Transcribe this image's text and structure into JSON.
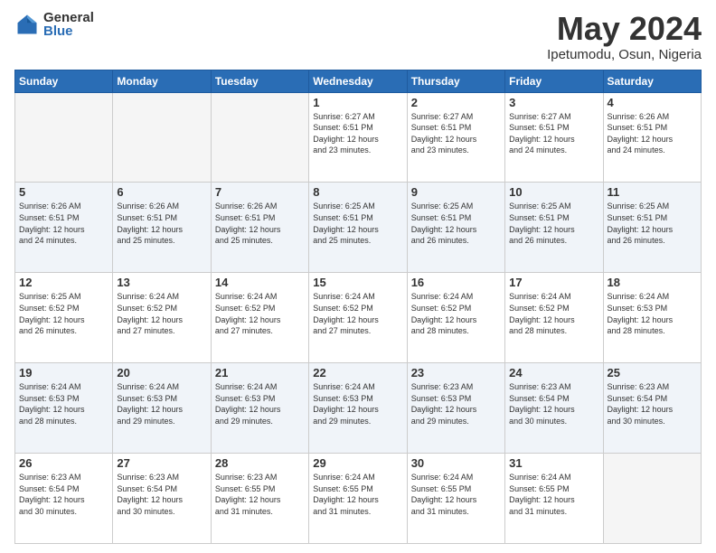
{
  "logo": {
    "general": "General",
    "blue": "Blue"
  },
  "header": {
    "title": "May 2024",
    "subtitle": "Ipetumodu, Osun, Nigeria"
  },
  "weekdays": [
    "Sunday",
    "Monday",
    "Tuesday",
    "Wednesday",
    "Thursday",
    "Friday",
    "Saturday"
  ],
  "weeks": [
    [
      {
        "day": "",
        "info": ""
      },
      {
        "day": "",
        "info": ""
      },
      {
        "day": "",
        "info": ""
      },
      {
        "day": "1",
        "info": "Sunrise: 6:27 AM\nSunset: 6:51 PM\nDaylight: 12 hours\nand 23 minutes."
      },
      {
        "day": "2",
        "info": "Sunrise: 6:27 AM\nSunset: 6:51 PM\nDaylight: 12 hours\nand 23 minutes."
      },
      {
        "day": "3",
        "info": "Sunrise: 6:27 AM\nSunset: 6:51 PM\nDaylight: 12 hours\nand 24 minutes."
      },
      {
        "day": "4",
        "info": "Sunrise: 6:26 AM\nSunset: 6:51 PM\nDaylight: 12 hours\nand 24 minutes."
      }
    ],
    [
      {
        "day": "5",
        "info": "Sunrise: 6:26 AM\nSunset: 6:51 PM\nDaylight: 12 hours\nand 24 minutes."
      },
      {
        "day": "6",
        "info": "Sunrise: 6:26 AM\nSunset: 6:51 PM\nDaylight: 12 hours\nand 25 minutes."
      },
      {
        "day": "7",
        "info": "Sunrise: 6:26 AM\nSunset: 6:51 PM\nDaylight: 12 hours\nand 25 minutes."
      },
      {
        "day": "8",
        "info": "Sunrise: 6:25 AM\nSunset: 6:51 PM\nDaylight: 12 hours\nand 25 minutes."
      },
      {
        "day": "9",
        "info": "Sunrise: 6:25 AM\nSunset: 6:51 PM\nDaylight: 12 hours\nand 26 minutes."
      },
      {
        "day": "10",
        "info": "Sunrise: 6:25 AM\nSunset: 6:51 PM\nDaylight: 12 hours\nand 26 minutes."
      },
      {
        "day": "11",
        "info": "Sunrise: 6:25 AM\nSunset: 6:51 PM\nDaylight: 12 hours\nand 26 minutes."
      }
    ],
    [
      {
        "day": "12",
        "info": "Sunrise: 6:25 AM\nSunset: 6:52 PM\nDaylight: 12 hours\nand 26 minutes."
      },
      {
        "day": "13",
        "info": "Sunrise: 6:24 AM\nSunset: 6:52 PM\nDaylight: 12 hours\nand 27 minutes."
      },
      {
        "day": "14",
        "info": "Sunrise: 6:24 AM\nSunset: 6:52 PM\nDaylight: 12 hours\nand 27 minutes."
      },
      {
        "day": "15",
        "info": "Sunrise: 6:24 AM\nSunset: 6:52 PM\nDaylight: 12 hours\nand 27 minutes."
      },
      {
        "day": "16",
        "info": "Sunrise: 6:24 AM\nSunset: 6:52 PM\nDaylight: 12 hours\nand 28 minutes."
      },
      {
        "day": "17",
        "info": "Sunrise: 6:24 AM\nSunset: 6:52 PM\nDaylight: 12 hours\nand 28 minutes."
      },
      {
        "day": "18",
        "info": "Sunrise: 6:24 AM\nSunset: 6:53 PM\nDaylight: 12 hours\nand 28 minutes."
      }
    ],
    [
      {
        "day": "19",
        "info": "Sunrise: 6:24 AM\nSunset: 6:53 PM\nDaylight: 12 hours\nand 28 minutes."
      },
      {
        "day": "20",
        "info": "Sunrise: 6:24 AM\nSunset: 6:53 PM\nDaylight: 12 hours\nand 29 minutes."
      },
      {
        "day": "21",
        "info": "Sunrise: 6:24 AM\nSunset: 6:53 PM\nDaylight: 12 hours\nand 29 minutes."
      },
      {
        "day": "22",
        "info": "Sunrise: 6:24 AM\nSunset: 6:53 PM\nDaylight: 12 hours\nand 29 minutes."
      },
      {
        "day": "23",
        "info": "Sunrise: 6:23 AM\nSunset: 6:53 PM\nDaylight: 12 hours\nand 29 minutes."
      },
      {
        "day": "24",
        "info": "Sunrise: 6:23 AM\nSunset: 6:54 PM\nDaylight: 12 hours\nand 30 minutes."
      },
      {
        "day": "25",
        "info": "Sunrise: 6:23 AM\nSunset: 6:54 PM\nDaylight: 12 hours\nand 30 minutes."
      }
    ],
    [
      {
        "day": "26",
        "info": "Sunrise: 6:23 AM\nSunset: 6:54 PM\nDaylight: 12 hours\nand 30 minutes."
      },
      {
        "day": "27",
        "info": "Sunrise: 6:23 AM\nSunset: 6:54 PM\nDaylight: 12 hours\nand 30 minutes."
      },
      {
        "day": "28",
        "info": "Sunrise: 6:23 AM\nSunset: 6:55 PM\nDaylight: 12 hours\nand 31 minutes."
      },
      {
        "day": "29",
        "info": "Sunrise: 6:24 AM\nSunset: 6:55 PM\nDaylight: 12 hours\nand 31 minutes."
      },
      {
        "day": "30",
        "info": "Sunrise: 6:24 AM\nSunset: 6:55 PM\nDaylight: 12 hours\nand 31 minutes."
      },
      {
        "day": "31",
        "info": "Sunrise: 6:24 AM\nSunset: 6:55 PM\nDaylight: 12 hours\nand 31 minutes."
      },
      {
        "day": "",
        "info": ""
      }
    ]
  ]
}
